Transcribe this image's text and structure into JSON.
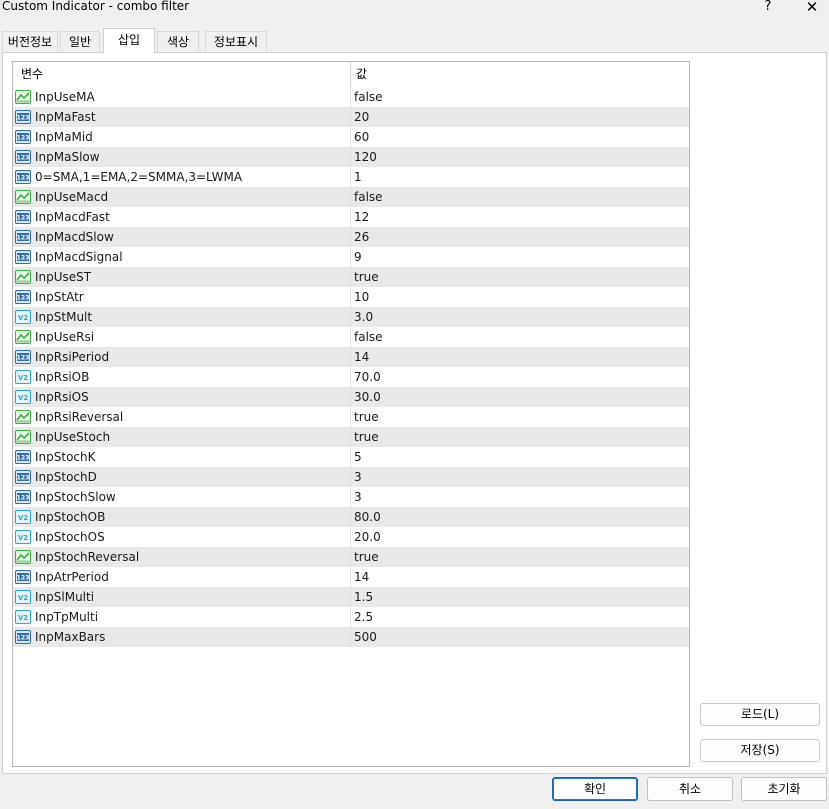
{
  "window": {
    "title": "Custom Indicator - combo filter",
    "help_label": "?",
    "close_label": "✕"
  },
  "tabs": [
    {
      "label": "버전정보"
    },
    {
      "label": "일반"
    },
    {
      "label": "삽입"
    },
    {
      "label": "색상"
    },
    {
      "label": "정보표시"
    }
  ],
  "active_tab": "삽입",
  "grid": {
    "header_name": "변수",
    "header_value": "값",
    "rows": [
      {
        "name": "InpUseMA",
        "value": "false",
        "icon": "boolean-icon"
      },
      {
        "name": "InpMaFast",
        "value": "20",
        "icon": "integer-icon"
      },
      {
        "name": "InpMaMid",
        "value": "60",
        "icon": "integer-icon"
      },
      {
        "name": "InpMaSlow",
        "value": "120",
        "icon": "integer-icon"
      },
      {
        "name": "0=SMA,1=EMA,2=SMMA,3=LWMA",
        "value": "1",
        "icon": "integer-icon"
      },
      {
        "name": "InpUseMacd",
        "value": "false",
        "icon": "boolean-icon"
      },
      {
        "name": "InpMacdFast",
        "value": "12",
        "icon": "integer-icon"
      },
      {
        "name": "InpMacdSlow",
        "value": "26",
        "icon": "integer-icon"
      },
      {
        "name": "InpMacdSignal",
        "value": "9",
        "icon": "integer-icon"
      },
      {
        "name": "InpUseST",
        "value": "true",
        "icon": "boolean-icon"
      },
      {
        "name": "InpStAtr",
        "value": "10",
        "icon": "integer-icon"
      },
      {
        "name": "InpStMult",
        "value": "3.0",
        "icon": "double-icon"
      },
      {
        "name": "InpUseRsi",
        "value": "false",
        "icon": "boolean-icon"
      },
      {
        "name": "InpRsiPeriod",
        "value": "14",
        "icon": "integer-icon"
      },
      {
        "name": "InpRsiOB",
        "value": "70.0",
        "icon": "double-icon"
      },
      {
        "name": "InpRsiOS",
        "value": "30.0",
        "icon": "double-icon"
      },
      {
        "name": "InpRsiReversal",
        "value": "true",
        "icon": "boolean-icon"
      },
      {
        "name": "InpUseStoch",
        "value": "true",
        "icon": "boolean-icon"
      },
      {
        "name": "InpStochK",
        "value": "5",
        "icon": "integer-icon"
      },
      {
        "name": "InpStochD",
        "value": "3",
        "icon": "integer-icon"
      },
      {
        "name": "InpStochSlow",
        "value": "3",
        "icon": "integer-icon"
      },
      {
        "name": "InpStochOB",
        "value": "80.0",
        "icon": "double-icon"
      },
      {
        "name": "InpStochOS",
        "value": "20.0",
        "icon": "double-icon"
      },
      {
        "name": "InpStochReversal",
        "value": "true",
        "icon": "boolean-icon"
      },
      {
        "name": "InpAtrPeriod",
        "value": "14",
        "icon": "integer-icon"
      },
      {
        "name": "InpSlMulti",
        "value": "1.5",
        "icon": "double-icon"
      },
      {
        "name": "InpTpMulti",
        "value": "2.5",
        "icon": "double-icon"
      },
      {
        "name": "InpMaxBars",
        "value": "500",
        "icon": "integer-icon"
      }
    ]
  },
  "side_buttons": {
    "load_label": "로드(L)",
    "save_label": "저장(S)"
  },
  "bottom_buttons": {
    "ok_label": "확인",
    "cancel_label": "취소",
    "reset_label": "초기화"
  },
  "icon_text": {
    "integer": "123",
    "double": "V2"
  },
  "colors": {
    "row_alt": "#e9e9e9",
    "boolean_icon_green": "#3cb043",
    "integer_icon_blue": "#2f6db5",
    "double_icon_cyan": "#2aa6d6",
    "primary_border": "#1f5fbf"
  }
}
